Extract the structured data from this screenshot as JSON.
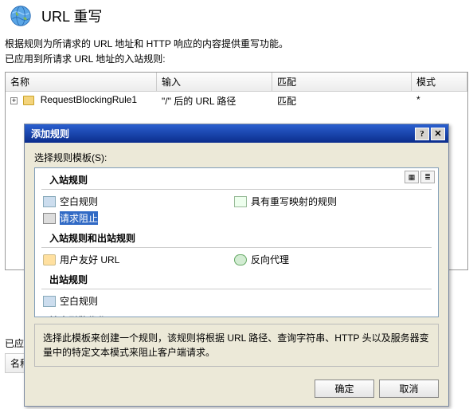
{
  "header": {
    "title": "URL 重写"
  },
  "desc": {
    "line1": "根据规则为所请求的 URL 地址和 HTTP 响应的内容提供重写功能。",
    "line2": "已应用到所请求 URL 地址的入站规则:"
  },
  "grid": {
    "columns": {
      "name": "名称",
      "input": "输入",
      "match": "匹配",
      "mode": "模式"
    },
    "row": {
      "name": "RequestBlockingRule1",
      "input": "\"/\" 后的 URL 路径",
      "match": "匹配",
      "mode": "*"
    }
  },
  "dialog": {
    "title": "添加规则",
    "help_btn": "?",
    "close_btn": "✕",
    "select_label": "选择规则模板(S):",
    "sections": {
      "inbound": "入站规则",
      "both": "入站规则和出站规则",
      "outbound": "出站规则",
      "seo": "搜索引擎优化 (SEO)"
    },
    "items": {
      "blank": "空白规则",
      "mapped": "具有重写映射的规则",
      "block": "请求阻止",
      "friendly": "用户友好 URL",
      "proxy": "反向代理",
      "blank_out": "空白规则"
    },
    "hint": "选择此模板来创建一个规则，该规则将根据 URL 路径、查询字符串、HTTP 头以及服务器变量中的特定文本模式来阻止客户端请求。",
    "ok": "确定",
    "cancel": "取消"
  },
  "under": {
    "applied": "已应",
    "name_col": "名称"
  }
}
